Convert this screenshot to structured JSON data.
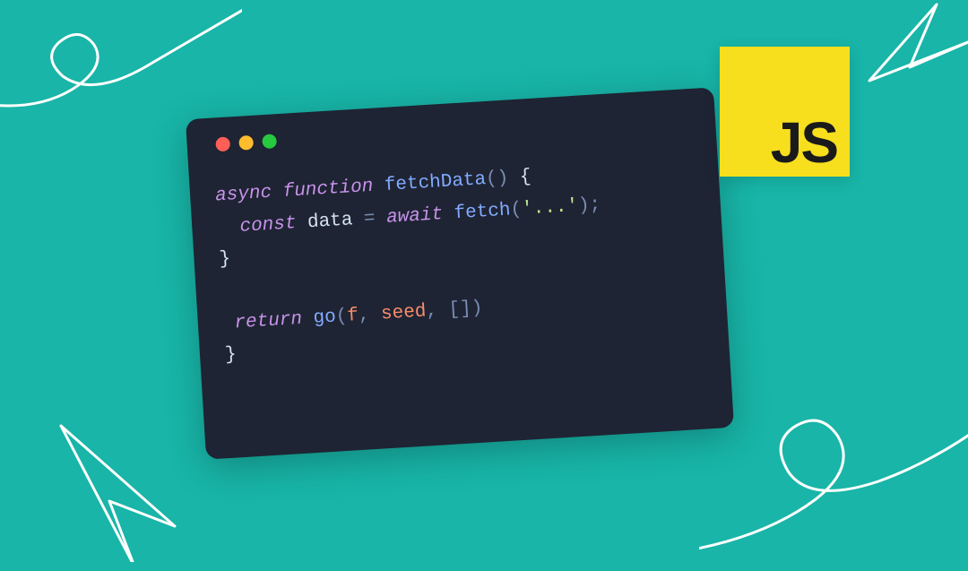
{
  "badge": {
    "label": "JS",
    "bg_color": "#f7df1e",
    "text_color": "#1a1a1a"
  },
  "window": {
    "bg_color": "#1e2433",
    "traffic_lights": [
      "#ff5f56",
      "#ffbd2e",
      "#27c93f"
    ]
  },
  "code": {
    "line1": {
      "kw_async": "async",
      "kw_function": "function",
      "fn_name": "fetchData",
      "parens_open": "(",
      "parens_close": ")",
      "brace_open": "{"
    },
    "line2": {
      "indent": "  ",
      "kw_const": "const",
      "var_name": "data",
      "equals": "=",
      "kw_await": "await",
      "fn_call": "fetch",
      "parens_open": "(",
      "string": "'...'",
      "parens_close": ")",
      "semicolon": ";"
    },
    "line3": {
      "brace_close": "}"
    },
    "line5": {
      "indent": " ",
      "kw_return": "return",
      "fn_call": "go",
      "parens_open": "(",
      "arg1": "f",
      "comma1": ",",
      "arg2": "seed",
      "comma2": ",",
      "arg3_open": "[",
      "arg3_close": "]",
      "parens_close": ")"
    },
    "line6": {
      "brace_close": "}"
    }
  },
  "background_color": "#18b5a8"
}
